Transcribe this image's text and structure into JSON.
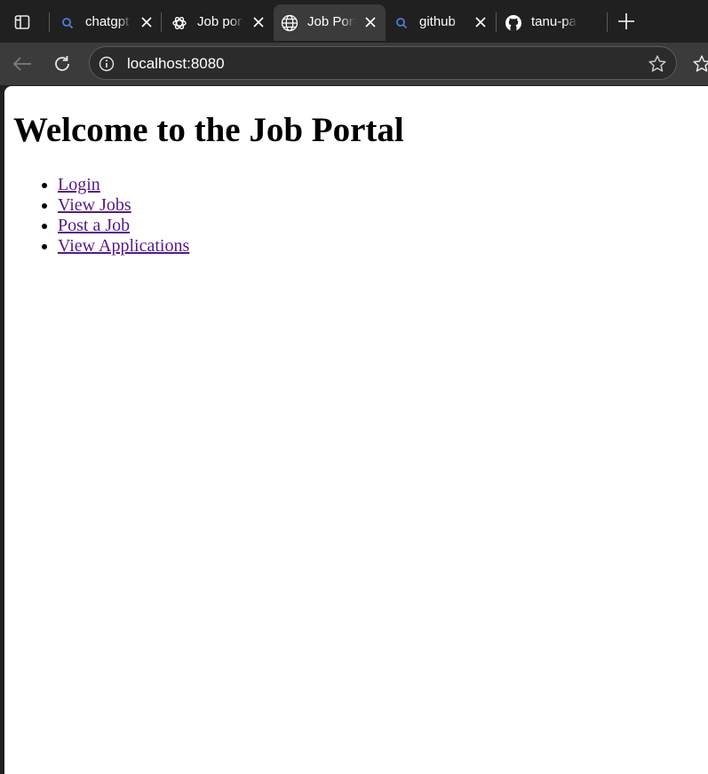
{
  "browser": {
    "tabs": [
      {
        "title": "chatgpt",
        "icon": "search-icon",
        "active": false
      },
      {
        "title": "Job portal",
        "icon": "openai-icon",
        "active": false
      },
      {
        "title": "Job Portal",
        "icon": "globe-icon",
        "active": true
      },
      {
        "title": "github",
        "icon": "search-icon",
        "active": false
      },
      {
        "title": "tanu-pa",
        "icon": "github-icon",
        "active": false
      }
    ],
    "address": {
      "url": "localhost:8080"
    }
  },
  "page": {
    "heading": "Welcome to the Job Portal",
    "nav": [
      {
        "label": "Login"
      },
      {
        "label": "View Jobs"
      },
      {
        "label": "Post a Job"
      },
      {
        "label": "View Applications"
      }
    ]
  },
  "colors": {
    "chrome_dark": "#202020",
    "toolbar": "#3b3b3b",
    "visited_link": "#551a8b"
  }
}
